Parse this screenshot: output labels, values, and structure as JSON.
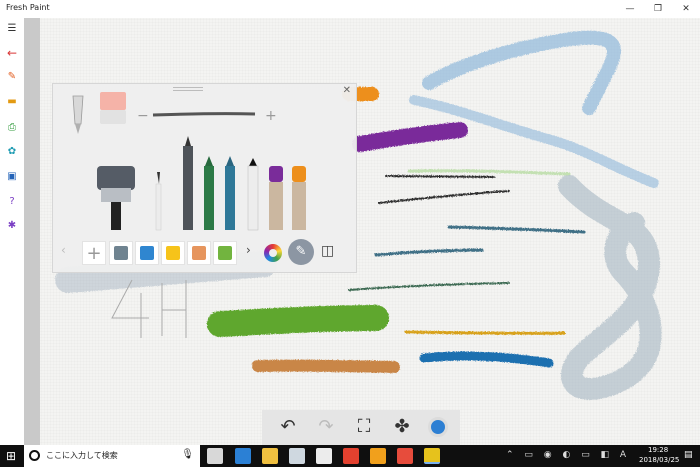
{
  "window": {
    "title": "Fresh Paint",
    "minimize_glyph": "—",
    "maximize_glyph": "❐",
    "close_glyph": "✕"
  },
  "sidebar": {
    "items": [
      {
        "icon": "hamburger-menu-icon",
        "glyph": "☰"
      },
      {
        "icon": "back-arrow-icon",
        "glyph": "←"
      },
      {
        "icon": "new-painting-icon",
        "glyph": "✎"
      },
      {
        "icon": "open-folder-icon",
        "glyph": "▬"
      },
      {
        "icon": "print-icon",
        "glyph": "⎙"
      },
      {
        "icon": "share-icon",
        "glyph": "✿"
      },
      {
        "icon": "save-icon",
        "glyph": "▣"
      },
      {
        "icon": "help-icon",
        "glyph": "?"
      },
      {
        "icon": "settings-gear-icon",
        "glyph": "✱"
      }
    ]
  },
  "tool_panel": {
    "close_glyph": "✕",
    "size_minus": "−",
    "size_plus": "+",
    "tools": [
      "palette-knife",
      "eraser",
      "flat-brush",
      "fine-brush",
      "pencil",
      "green-pencil",
      "teal-pencil",
      "pen",
      "purple-marker",
      "orange-marker"
    ],
    "swatches": [
      {
        "name": "slate-gray",
        "color": "#6f8390"
      },
      {
        "name": "blue",
        "color": "#2f86d0"
      },
      {
        "name": "yellow",
        "color": "#f6c31a"
      },
      {
        "name": "orange",
        "color": "#e6955d"
      },
      {
        "name": "green",
        "color": "#72b43f"
      }
    ],
    "add_color_glyph": "+",
    "prev_glyph": "‹",
    "next_glyph": "›",
    "brush_mode_glyph": "✎",
    "easel_glyph": "◫"
  },
  "canvas": {
    "paper_color": "#f4f4f2",
    "strokes": [
      {
        "name": "orange",
        "color": "#ed8f1c"
      },
      {
        "name": "purple",
        "color": "#7a2c9a"
      },
      {
        "name": "light-blue",
        "color": "#8fb8da"
      },
      {
        "name": "gray-blue",
        "color": "#9fb0be"
      },
      {
        "name": "green",
        "color": "#5ea72e"
      },
      {
        "name": "brown-orange",
        "color": "#c98647"
      },
      {
        "name": "mustard",
        "color": "#d8a21c"
      },
      {
        "name": "blue",
        "color": "#1f6fb0"
      },
      {
        "name": "teal",
        "color": "#3f6f86"
      },
      {
        "name": "dark-green",
        "color": "#3e6b52"
      },
      {
        "name": "light-green",
        "color": "#b8dca2"
      },
      {
        "name": "charcoal",
        "color": "#2d2d2d"
      }
    ]
  },
  "appbar": {
    "undo_glyph": "↶",
    "redo_glyph": "↷",
    "fit_glyph": "⛶",
    "clover_glyph": "✤"
  },
  "taskbar": {
    "start_glyph": "⊞",
    "search_placeholder": "ここに入力して検索",
    "mic_glyph": "🎙",
    "tray_glyphs": "⌃ ▭ ◉ ◐ ▭ ◧ A",
    "time": "19:28",
    "date": "2018/03/25",
    "notification_glyph": "▤",
    "pinned_apps": [
      {
        "name": "task-view-icon",
        "color": "#d8d8d8"
      },
      {
        "name": "edge-icon",
        "color": "#2b80d5"
      },
      {
        "name": "file-explorer-icon",
        "color": "#f0c040"
      },
      {
        "name": "store-icon",
        "color": "#cfd8e0"
      },
      {
        "name": "mail-icon",
        "color": "#ececec"
      },
      {
        "name": "chrome-icon",
        "color": "#e3412f"
      },
      {
        "name": "photos-icon",
        "color": "#f1a01c"
      },
      {
        "name": "media-player-icon",
        "color": "#e74c3c"
      },
      {
        "name": "fresh-paint-icon",
        "color": "#e6c21c"
      }
    ]
  }
}
